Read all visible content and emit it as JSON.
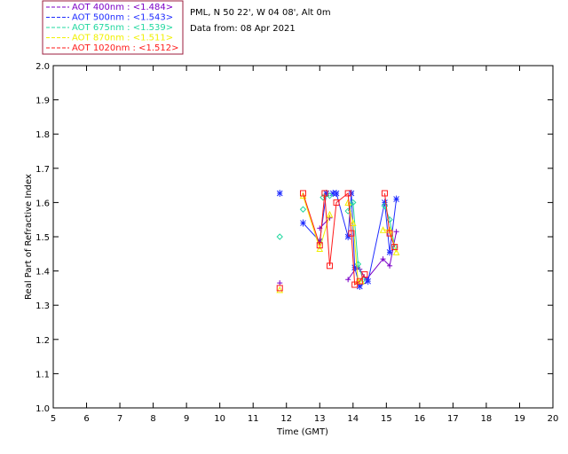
{
  "site_info": {
    "line1": "PML, N 50 22', W 04 08', Alt 0m",
    "line2": "Data from: 08 Apr 2021"
  },
  "chart_data": {
    "type": "scatter",
    "xlabel": "Time (GMT)",
    "ylabel": "Real Part of Refractive Index",
    "xlim": [
      5,
      20
    ],
    "ylim": [
      1.0,
      2.0
    ],
    "x_ticks": [
      "5",
      "6",
      "7",
      "8",
      "9",
      "10",
      "11",
      "12",
      "13",
      "14",
      "15",
      "16",
      "17",
      "18",
      "19",
      "20"
    ],
    "y_ticks": [
      "1.0",
      "1.1",
      "1.2",
      "1.3",
      "1.4",
      "1.5",
      "1.6",
      "1.7",
      "1.8",
      "1.9",
      "2.0"
    ],
    "legend_position": "top-left, outside plot",
    "series": [
      {
        "name": "AOT  400nm : <1.484>",
        "color": "#7b00c8",
        "marker": "plus",
        "points": [
          [
            11.8,
            1.365
          ],
          [
            13.0,
            1.525
          ],
          [
            13.3,
            1.555
          ],
          [
            13.85,
            1.375
          ],
          [
            14.1,
            1.41
          ],
          [
            14.2,
            1.405
          ],
          [
            14.4,
            1.375
          ],
          [
            14.9,
            1.435
          ],
          [
            15.1,
            1.415
          ],
          [
            15.3,
            1.515
          ]
        ]
      },
      {
        "name": "AOT  500nm : <1.543>",
        "color": "#1f2cff",
        "marker": "star",
        "points": [
          [
            11.8,
            1.627
          ],
          [
            12.5,
            1.54
          ],
          [
            13.0,
            1.487
          ],
          [
            13.2,
            1.627
          ],
          [
            13.4,
            1.627
          ],
          [
            13.5,
            1.627
          ],
          [
            13.85,
            1.5
          ],
          [
            13.95,
            1.627
          ],
          [
            14.05,
            1.41
          ],
          [
            14.2,
            1.355
          ],
          [
            14.45,
            1.37
          ],
          [
            14.95,
            1.6
          ],
          [
            15.1,
            1.455
          ],
          [
            15.3,
            1.61
          ]
        ]
      },
      {
        "name": "AOT  675nm : <1.539>",
        "color": "#22d8a0",
        "marker": "diamond",
        "points": [
          [
            11.8,
            1.5
          ],
          [
            12.5,
            1.58
          ],
          [
            13.1,
            1.615
          ],
          [
            13.3,
            1.62
          ],
          [
            13.85,
            1.575
          ],
          [
            14.0,
            1.6
          ],
          [
            14.15,
            1.42
          ],
          [
            14.3,
            1.375
          ],
          [
            14.95,
            1.59
          ],
          [
            15.1,
            1.55
          ],
          [
            15.25,
            1.47
          ]
        ]
      },
      {
        "name": "AOT  870nm : <1.511>",
        "color": "#f0f000",
        "marker": "triangle",
        "points": [
          [
            11.8,
            1.345
          ],
          [
            12.5,
            1.62
          ],
          [
            13.0,
            1.465
          ],
          [
            13.3,
            1.565
          ],
          [
            13.85,
            1.6
          ],
          [
            14.0,
            1.54
          ],
          [
            14.15,
            1.37
          ],
          [
            14.25,
            1.37
          ],
          [
            14.9,
            1.52
          ],
          [
            15.1,
            1.52
          ],
          [
            15.3,
            1.455
          ]
        ]
      },
      {
        "name": "AOT 1020nm : <1.512>",
        "color": "#ff1a1a",
        "marker": "square",
        "points": [
          [
            11.8,
            1.35
          ],
          [
            12.5,
            1.627
          ],
          [
            13.0,
            1.475
          ],
          [
            13.15,
            1.627
          ],
          [
            13.3,
            1.415
          ],
          [
            13.5,
            1.6
          ],
          [
            13.85,
            1.627
          ],
          [
            13.95,
            1.51
          ],
          [
            14.05,
            1.36
          ],
          [
            14.2,
            1.37
          ],
          [
            14.35,
            1.39
          ],
          [
            14.95,
            1.627
          ],
          [
            15.1,
            1.51
          ],
          [
            15.25,
            1.47
          ]
        ]
      }
    ]
  }
}
